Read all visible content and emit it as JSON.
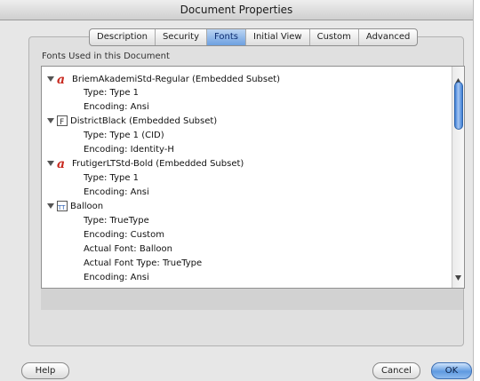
{
  "window": {
    "title": "Document Properties"
  },
  "tabs": [
    {
      "label": "Description",
      "active": false
    },
    {
      "label": "Security",
      "active": false
    },
    {
      "label": "Fonts",
      "active": true
    },
    {
      "label": "Initial View",
      "active": false
    },
    {
      "label": "Custom",
      "active": false
    },
    {
      "label": "Advanced",
      "active": false
    }
  ],
  "fonts_section": {
    "label": "Fonts Used in this Document",
    "fonts": [
      {
        "name": "BriemAkademiStd-Regular (Embedded Subset)",
        "icon": "opentype-font-icon",
        "details": [
          "Type: Type 1",
          "Encoding: Ansi"
        ]
      },
      {
        "name": "DistrictBlack (Embedded Subset)",
        "icon": "postscript-font-icon",
        "details": [
          "Type: Type 1 (CID)",
          "Encoding: Identity-H"
        ]
      },
      {
        "name": "FrutigerLTStd-Bold (Embedded Subset)",
        "icon": "opentype-font-icon",
        "details": [
          "Type: Type 1",
          "Encoding: Ansi"
        ]
      },
      {
        "name": "Balloon",
        "icon": "truetype-font-icon",
        "details": [
          "Type: TrueType",
          "Encoding: Custom",
          "Actual Font: Balloon",
          "Actual Font Type: TrueType",
          "Encoding: Ansi"
        ]
      }
    ]
  },
  "buttons": {
    "help": "Help",
    "cancel": "Cancel",
    "ok": "OK"
  },
  "colors": {
    "accent": "#5f9ae0",
    "opentype_icon": "#c8281e"
  }
}
